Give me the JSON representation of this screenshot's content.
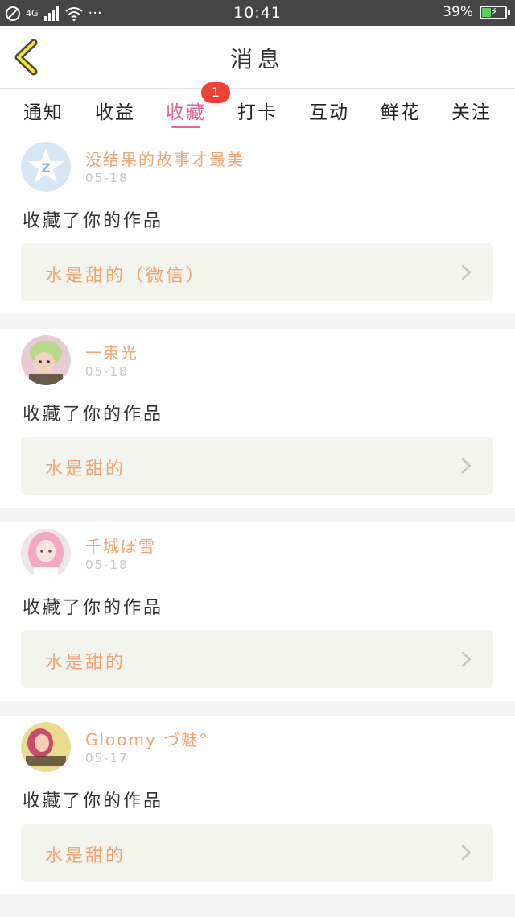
{
  "status_bar": {
    "signal": "4G",
    "dots": "···",
    "time": "10:41",
    "battery": "39%",
    "battery_level": 0.39
  },
  "header": {
    "title": "消息"
  },
  "tabs": [
    {
      "label": "通知"
    },
    {
      "label": "收益"
    },
    {
      "label": "收藏",
      "active": true
    },
    {
      "label": "打卡"
    },
    {
      "label": "互动"
    },
    {
      "label": "鲜花"
    },
    {
      "label": "关注"
    }
  ],
  "badge": "1",
  "colors": {
    "accent": "#e2659c",
    "username": "#f0a470",
    "badge": "#f0413b"
  },
  "feed": [
    {
      "username": "没结果的故事才最美",
      "date": "05-18",
      "action": "收藏了你的作品",
      "work": "水是甜的（微信）",
      "avatar": "default-star-avatar"
    },
    {
      "username": "一束光",
      "date": "05-18",
      "action": "收藏了你的作品",
      "work": "水是甜的",
      "avatar": "photo-avatar-green"
    },
    {
      "username": "千城ぼ雪",
      "date": "05-18",
      "action": "收藏了你的作品",
      "work": "水是甜的",
      "avatar": "photo-avatar-pink"
    },
    {
      "username": "Gloomy づ魅°",
      "date": "05-17",
      "action": "收藏了你的作品",
      "work": "水是甜的",
      "avatar": "photo-avatar-warm"
    }
  ]
}
